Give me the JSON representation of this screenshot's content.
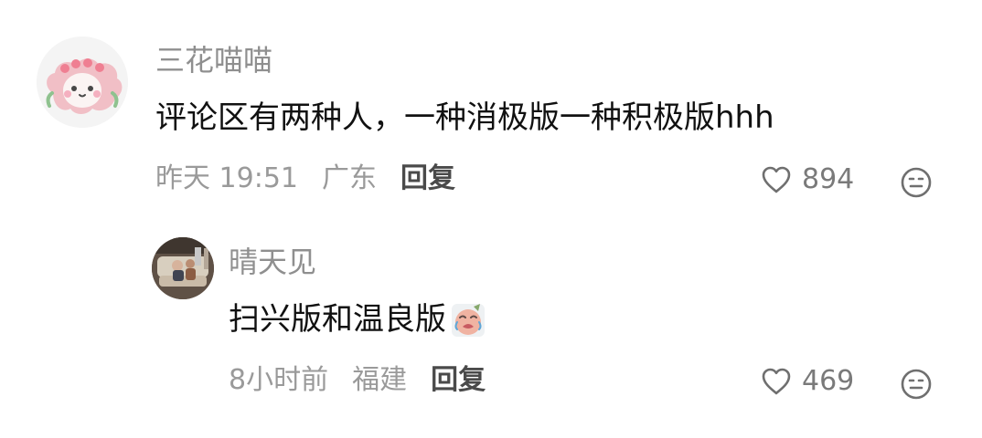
{
  "comment": {
    "user": {
      "name": "三花喵喵",
      "avatar_icon": "pink-cartoon-sheep-avatar"
    },
    "text": "评论区有两种人，一种消极版一种积极版hhh",
    "meta": {
      "time": "昨天 19:51",
      "location": "广东",
      "reply_label": "回复"
    },
    "likes": "894",
    "icons": {
      "like": "heart-outline-icon",
      "reaction": "emoji-face-icon"
    }
  },
  "reply": {
    "user": {
      "name": "晴天见",
      "avatar_icon": "couple-sitting-on-sofa-photo-avatar"
    },
    "text": "扫兴版和温良版",
    "sticker": "crying-face-sticker",
    "meta": {
      "time": "8小时前",
      "location": "福建",
      "reply_label": "回复"
    },
    "likes": "469",
    "icons": {
      "like": "heart-outline-icon",
      "reaction": "emoji-face-icon"
    }
  },
  "colors": {
    "username": "#8f8f8f",
    "content": "#111111",
    "meta": "#9a9a9a",
    "reply": "#4a4a4a",
    "icon": "#6f6f6f"
  }
}
